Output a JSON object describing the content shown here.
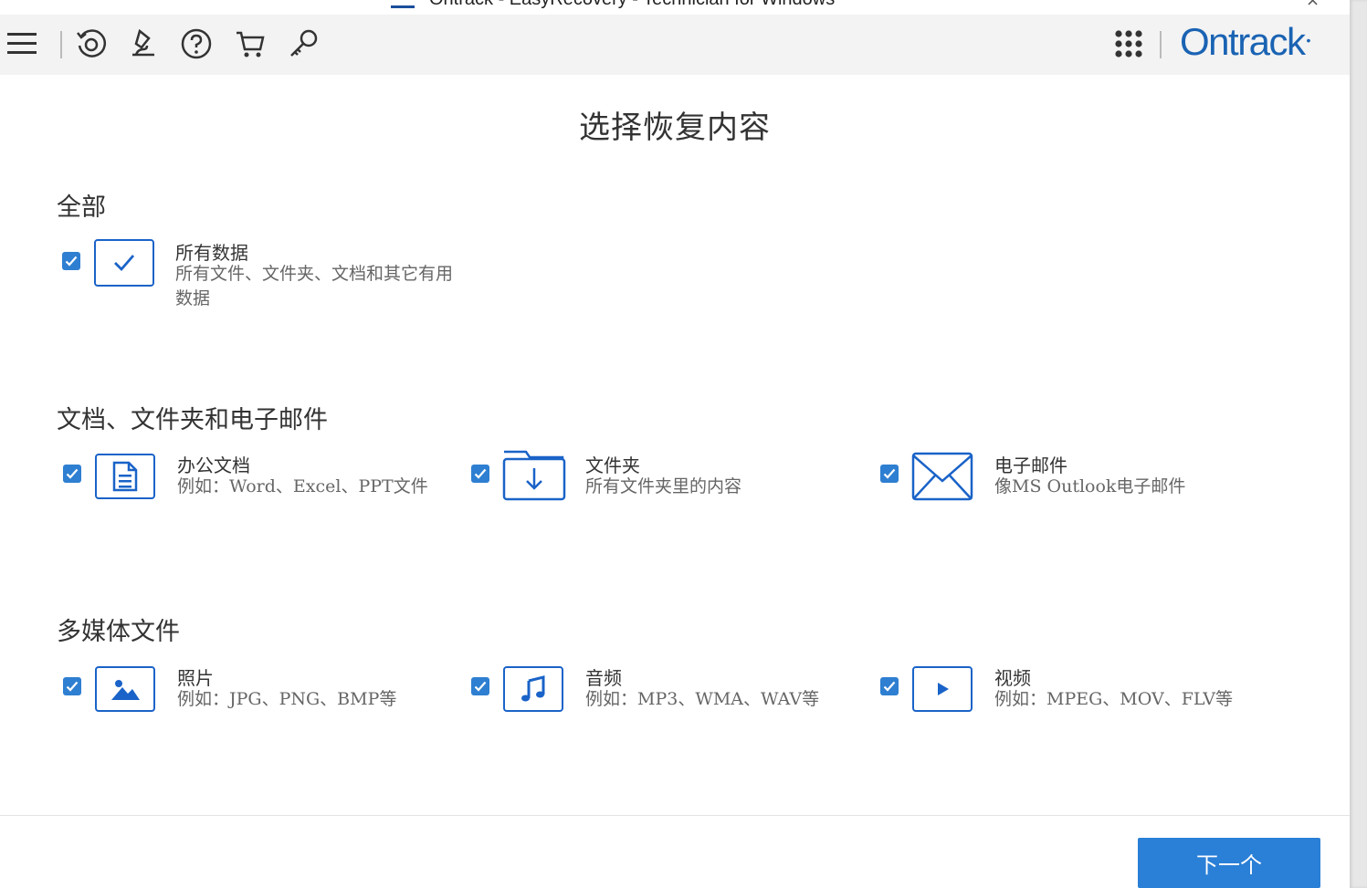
{
  "window": {
    "title": "Ontrack - EasyRecovery - Technician for Windows",
    "close_glyph": "×"
  },
  "toolbar": {
    "icons": [
      "menu-icon",
      "recover-icon",
      "diagnose-icon",
      "help-icon",
      "cart-icon",
      "key-icon"
    ],
    "apps_icon": "apps-grid-icon",
    "brand": "Ontrack",
    "brand_mark": "•"
  },
  "page_title": "选择恢复内容",
  "sections": {
    "all": {
      "title": "全部",
      "items": [
        {
          "label": "所有数据",
          "desc": "所有文件、文件夹、文档和其它有用数据",
          "icon": "check-all-icon",
          "checked": true
        }
      ]
    },
    "docs": {
      "title": "文档、文件夹和电子邮件",
      "items": [
        {
          "label": "办公文档",
          "desc": "例如：Word、Excel、PPT文件",
          "icon": "document-icon",
          "checked": true
        },
        {
          "label": "文件夹",
          "desc": "所有文件夹里的内容",
          "icon": "folder-icon",
          "checked": true
        },
        {
          "label": "电子邮件",
          "desc": "像MS Outlook电子邮件",
          "icon": "envelope-icon",
          "checked": true
        }
      ]
    },
    "media": {
      "title": "多媒体文件",
      "items": [
        {
          "label": "照片",
          "desc": "例如：JPG、PNG、BMP等",
          "icon": "photo-icon",
          "checked": true
        },
        {
          "label": "音频",
          "desc": "例如：MP3、WMA、WAV等",
          "icon": "music-icon",
          "checked": true
        },
        {
          "label": "视频",
          "desc": "例如：MPEG、MOV、FLV等",
          "icon": "video-icon",
          "checked": true
        }
      ]
    }
  },
  "footer": {
    "next_label": "下一个"
  },
  "colors": {
    "accent": "#2a7fd6",
    "brand": "#1a63b3",
    "toolbar_bg": "#f3f3f3"
  }
}
